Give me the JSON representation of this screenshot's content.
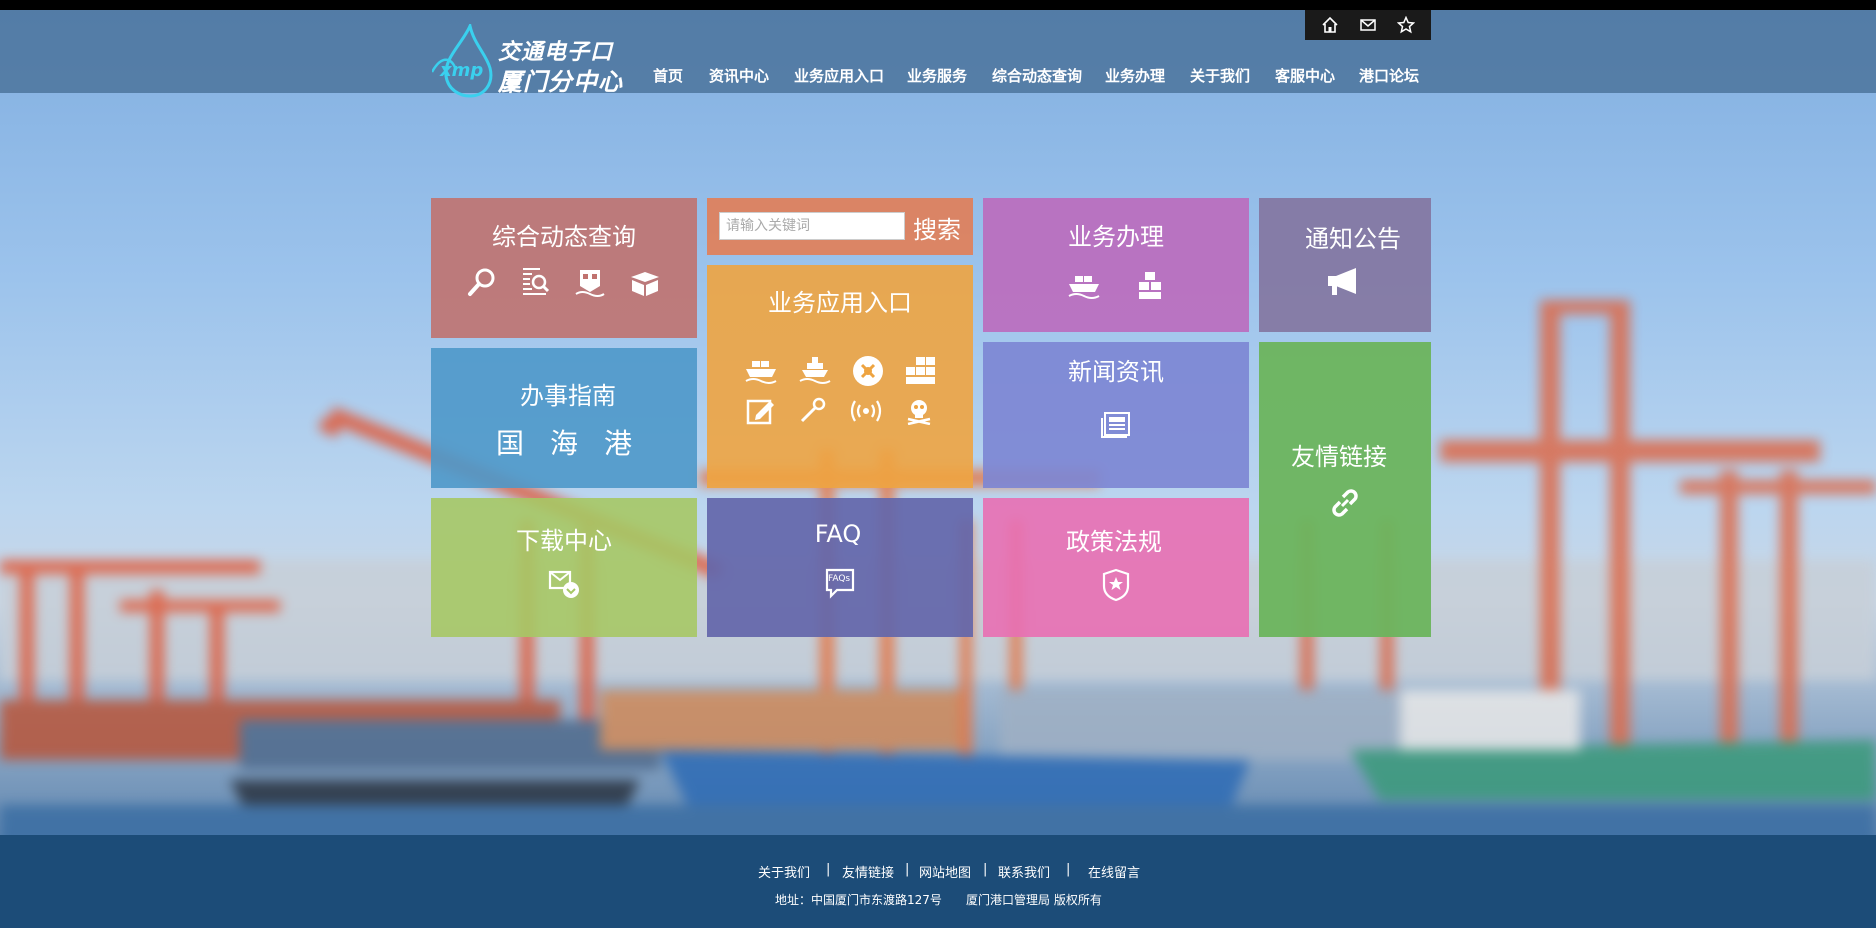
{
  "logo": {
    "line1": "交通电子口岸",
    "line2": "厦门分中心",
    "mark": "xmp"
  },
  "util_icons": [
    "home-icon",
    "mail-icon",
    "star-icon"
  ],
  "nav": [
    "首页",
    "资讯中心",
    "业务应用入口",
    "业务服务",
    "综合动态查询",
    "业务办理",
    "关于我们",
    "客服中心",
    "港口论坛"
  ],
  "search": {
    "placeholder": "请输入关键词",
    "button": "搜索"
  },
  "tiles": {
    "dynamic_query": {
      "title": "综合动态查询",
      "color": "#c0726f",
      "icons": [
        "search-icon",
        "document-search-icon",
        "ship-front-icon",
        "package-icon"
      ]
    },
    "app_entry": {
      "title": "业务应用入口",
      "color": "#eea441",
      "icons": [
        "cargo-ship-icon",
        "vessel-icon",
        "hazard-icon",
        "containers-icon",
        "edit-icon",
        "pen-icon",
        "signal-icon",
        "skull-icon"
      ]
    },
    "business": {
      "title": "业务办理",
      "color": "#bb6abc",
      "icons": [
        "cargo-ship-icon",
        "boxes-icon"
      ]
    },
    "notice": {
      "title": "通知公告",
      "color": "#8376a1",
      "icons": [
        "megaphone-icon"
      ]
    },
    "guide": {
      "title": "办事指南",
      "color": "#4e98c9",
      "labels": [
        "国",
        "海",
        "港"
      ]
    },
    "news": {
      "title": "新闻资讯",
      "color": "#7d87d4",
      "icons": [
        "newspaper-icon"
      ]
    },
    "links": {
      "title": "友情链接",
      "color": "#6bb45d",
      "icons": [
        "link-icon"
      ]
    },
    "download": {
      "title": "下载中心",
      "color": "#a6c865",
      "icons": [
        "download-mail-icon"
      ]
    },
    "faq": {
      "title": "FAQ",
      "color": "#6366aa",
      "icons": [
        "faq-bubble-icon"
      ],
      "icon_text": "FAQs"
    },
    "policy": {
      "title": "政策法规",
      "color": "#e86fb2",
      "icons": [
        "police-badge-icon"
      ]
    }
  },
  "footer": {
    "links": [
      "关于我们",
      "友情链接",
      "网站地图",
      "联系我们",
      "在线留言"
    ],
    "separator": "|",
    "address": "地址：中国厦门市东渡路127号",
    "copyright": "厦门港口管理局 版权所有"
  }
}
